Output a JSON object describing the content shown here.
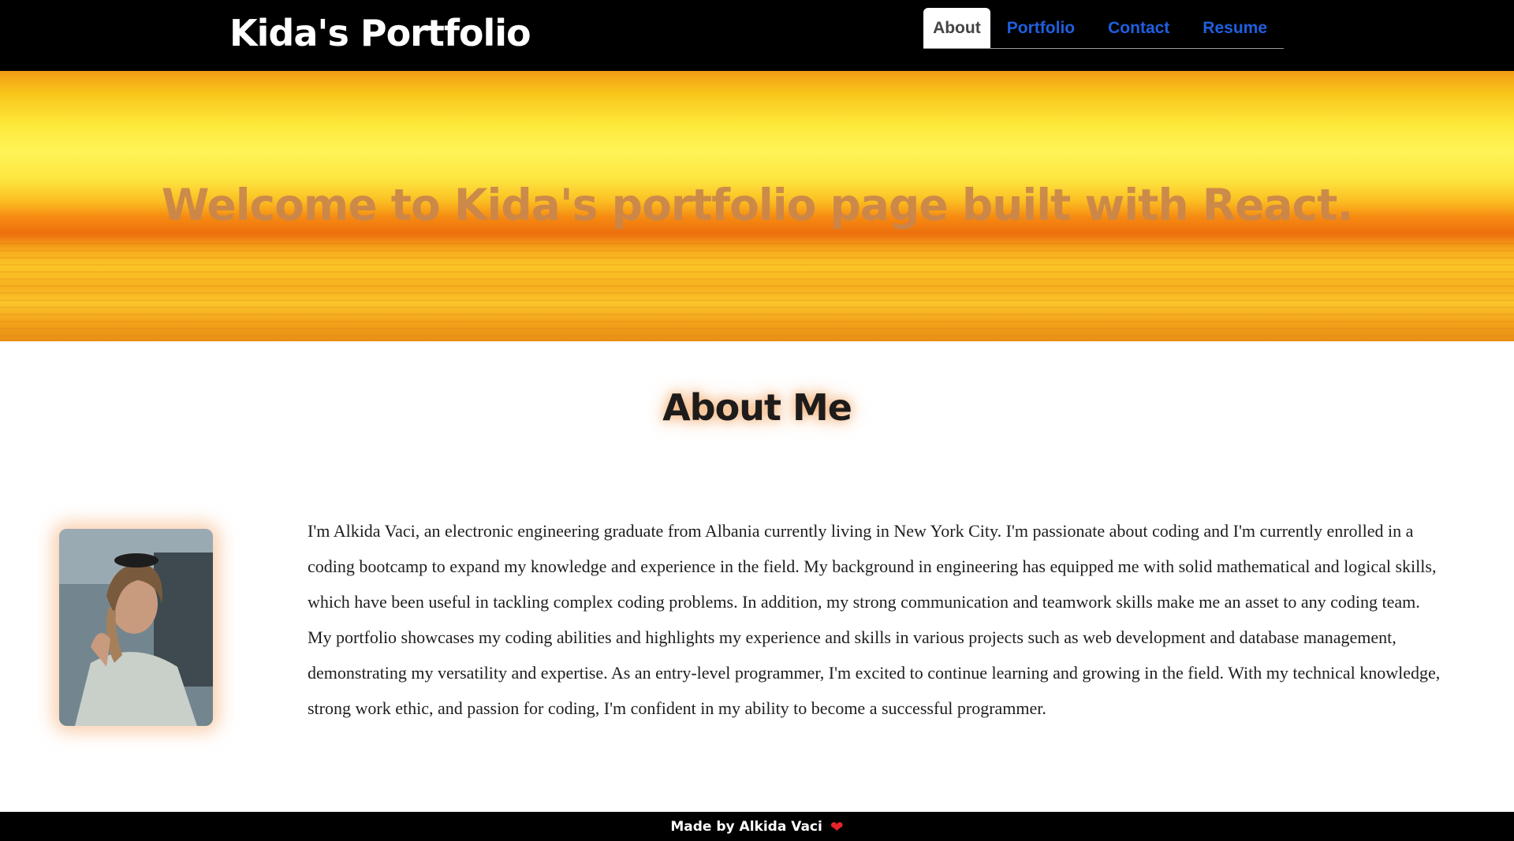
{
  "header": {
    "brand": "Kida's Portfolio",
    "nav": [
      {
        "label": "About",
        "active": true
      },
      {
        "label": "Portfolio",
        "active": false
      },
      {
        "label": "Contact",
        "active": false
      },
      {
        "label": "Resume",
        "active": false
      }
    ]
  },
  "hero": {
    "title": "Welcome to Kida's portfolio page built with React."
  },
  "about": {
    "title": "About Me",
    "text": "I'm Alkida Vaci, an electronic engineering graduate from Albania currently living in New York City. I'm passionate about coding and I'm currently enrolled in a coding bootcamp to expand my knowledge and experience in the field. My background in engineering has equipped me with solid mathematical and logical skills, which have been useful in tackling complex coding problems. In addition, my strong communication and teamwork skills make me an asset to any coding team. My portfolio showcases my coding abilities and highlights my experience and skills in various projects such as web development and database management, demonstrating my versatility and expertise. As an entry-level programmer, I'm excited to continue learning and growing in the field. With my technical knowledge, strong work ethic, and passion for coding, I'm confident in my ability to become a successful programmer."
  },
  "footer": {
    "text": "Made by Alkida Vaci"
  },
  "colors": {
    "header_bg": "#000000",
    "nav_link": "#1f5fe0",
    "nav_active_text": "#444444",
    "heart": "#e5242b"
  }
}
